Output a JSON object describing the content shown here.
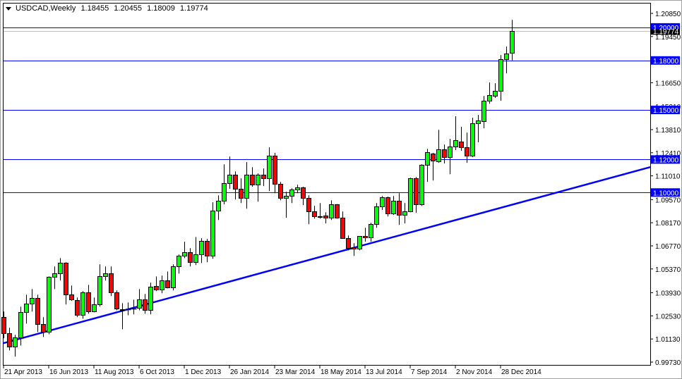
{
  "header": {
    "symbol": "USDCAD,Weekly",
    "open": "1.18455",
    "high": "1.20455",
    "low": "1.18009",
    "close": "1.19774"
  },
  "chart_data": {
    "type": "candlestick",
    "title": "USDCAD,Weekly",
    "ylim": [
      0.9973,
      1.2085
    ],
    "y_ticks": [
      "1.20850",
      "1.19450",
      "1.16650",
      "1.15210",
      "1.13810",
      "1.12410",
      "1.11010",
      "1.09570",
      "1.08170",
      "1.06770",
      "1.05370",
      "1.03930",
      "1.02530",
      "1.01130",
      "0.99730"
    ],
    "x_labels": [
      {
        "bar": 0,
        "label": "21 Apr 2013"
      },
      {
        "bar": 8,
        "label": "16 Jun 2013"
      },
      {
        "bar": 16,
        "label": "11 Aug 2013"
      },
      {
        "bar": 24,
        "label": "6 Oct 2013"
      },
      {
        "bar": 32,
        "label": "1 Dec 2013"
      },
      {
        "bar": 40,
        "label": "26 Jan 2014"
      },
      {
        "bar": 48,
        "label": "23 Mar 2014"
      },
      {
        "bar": 56,
        "label": "18 May 2014"
      },
      {
        "bar": 64,
        "label": "13 Jul 2014"
      },
      {
        "bar": 72,
        "label": "7 Sep 2014"
      },
      {
        "bar": 80,
        "label": "2 Nov 2014"
      },
      {
        "bar": 88,
        "label": "28 Dec 2014"
      }
    ],
    "horizontal_levels": [
      {
        "price": 1.2,
        "label": "1.20000"
      },
      {
        "price": 1.18,
        "label": "1.18000"
      },
      {
        "price": 1.15,
        "label": "1.15000"
      },
      {
        "price": 1.12,
        "label": "1.12000"
      },
      {
        "price": 1.1,
        "label": "1.10000"
      }
    ],
    "current_price": {
      "price": 1.19774,
      "label": "1.19774"
    },
    "trendline": [
      {
        "bar": -0.1,
        "price": 1.0087
      },
      {
        "bar": 114.5,
        "price": 1.1154
      }
    ],
    "colors": {
      "up": "#00ff00",
      "down": "#ff0000",
      "level": "#0000ff",
      "trend": "#0000ff"
    },
    "ohlc": [
      [
        1.0245,
        1.0279,
        1.0117,
        1.0146
      ],
      [
        1.0146,
        1.0181,
        1.0044,
        1.0065
      ],
      [
        1.0065,
        1.0138,
        1.0006,
        1.0121
      ],
      [
        1.0121,
        1.0309,
        1.0074,
        1.0275
      ],
      [
        1.0275,
        1.0381,
        1.0206,
        1.0326
      ],
      [
        1.0326,
        1.0415,
        1.0279,
        1.036
      ],
      [
        1.036,
        1.0381,
        1.0155,
        1.0202
      ],
      [
        1.0202,
        1.0245,
        1.0125,
        1.0155
      ],
      [
        1.0155,
        1.0492,
        1.0142,
        1.0488
      ],
      [
        1.0488,
        1.0552,
        1.0415,
        1.0509
      ],
      [
        1.0509,
        1.0603,
        1.0467,
        1.0573
      ],
      [
        1.0573,
        1.0578,
        1.0322,
        1.0381
      ],
      [
        1.0381,
        1.0437,
        1.0343,
        1.0351
      ],
      [
        1.0347,
        1.0364,
        1.0245,
        1.0257
      ],
      [
        1.0257,
        1.0403,
        1.0236,
        1.0394
      ],
      [
        1.0394,
        1.0441,
        1.0266,
        1.0279
      ],
      [
        1.0279,
        1.0364,
        1.0275,
        1.0322
      ],
      [
        1.0322,
        1.0565,
        1.0309,
        1.0492
      ],
      [
        1.0492,
        1.0552,
        1.0467,
        1.0509
      ],
      [
        1.0509,
        1.0552,
        1.0373,
        1.0394
      ],
      [
        1.0394,
        1.0407,
        1.0287,
        1.0296
      ],
      [
        1.0292,
        1.033,
        1.0172,
        1.029
      ],
      [
        1.0292,
        1.0334,
        1.0257,
        1.0294
      ],
      [
        1.0296,
        1.0351,
        1.0262,
        1.0298
      ],
      [
        1.03,
        1.0415,
        1.0287,
        1.0351
      ],
      [
        1.0351,
        1.0386,
        1.0266,
        1.0287
      ],
      [
        1.0287,
        1.0454,
        1.0262,
        1.0428
      ],
      [
        1.0433,
        1.0492,
        1.0403,
        1.0411
      ],
      [
        1.0411,
        1.0497,
        1.039,
        1.0467
      ],
      [
        1.0467,
        1.0522,
        1.042,
        1.0424
      ],
      [
        1.0424,
        1.0565,
        1.0407,
        1.0552
      ],
      [
        1.0552,
        1.0625,
        1.0509,
        1.0616
      ],
      [
        1.0616,
        1.0702,
        1.0603,
        1.0637
      ],
      [
        1.0637,
        1.0663,
        1.0552,
        1.0578
      ],
      [
        1.0578,
        1.0731,
        1.0561,
        1.0625
      ],
      [
        1.0625,
        1.0723,
        1.0573,
        1.0706
      ],
      [
        1.0706,
        1.0719,
        1.0578,
        1.0616
      ],
      [
        1.0616,
        1.0941,
        1.0599,
        1.0889
      ],
      [
        1.0889,
        1.0983,
        1.0834,
        1.0949
      ],
      [
        1.0949,
        1.1171,
        1.0928,
        1.1056
      ],
      [
        1.1056,
        1.1218,
        1.1022,
        1.1107
      ],
      [
        1.1107,
        1.1128,
        1.0958,
        1.1022
      ],
      [
        1.1022,
        1.1086,
        1.0936,
        1.0966
      ],
      [
        1.0966,
        1.1184,
        1.0902,
        1.1107
      ],
      [
        1.1107,
        1.1154,
        1.1035,
        1.1047
      ],
      [
        1.1047,
        1.1116,
        1.0945,
        1.1107
      ],
      [
        1.1107,
        1.1146,
        1.1039,
        1.1086
      ],
      [
        1.1086,
        1.1274,
        1.1009,
        1.1222
      ],
      [
        1.1222,
        1.124,
        1.0996,
        1.1052
      ],
      [
        1.1052,
        1.1064,
        1.0953,
        1.0966
      ],
      [
        1.0966,
        1.1005,
        1.0847,
        1.0979
      ],
      [
        1.0979,
        1.1026,
        1.0936,
        1.1018
      ],
      [
        1.1018,
        1.1047,
        1.0996,
        1.103
      ],
      [
        1.103,
        1.1035,
        1.0924,
        1.0966
      ],
      [
        1.0966,
        1.0983,
        1.0808,
        1.0885
      ],
      [
        1.0885,
        1.0919,
        1.0842,
        1.0855
      ],
      [
        1.0855,
        1.0936,
        1.0842,
        1.0853
      ],
      [
        1.086,
        1.0881,
        1.0813,
        1.0847
      ],
      [
        1.0847,
        1.0953,
        1.0834,
        1.0928
      ],
      [
        1.0928,
        1.093,
        1.0842,
        1.0847
      ],
      [
        1.0847,
        1.0885,
        1.0723,
        1.0723
      ],
      [
        1.0723,
        1.074,
        1.065,
        1.0663
      ],
      [
        1.0667,
        1.0693,
        1.0616,
        1.0659
      ],
      [
        1.0659,
        1.0736,
        1.065,
        1.0736
      ],
      [
        1.0736,
        1.0787,
        1.0702,
        1.0727
      ],
      [
        1.0727,
        1.0817,
        1.0702,
        1.0808
      ],
      [
        1.0808,
        1.0936,
        1.0787,
        1.0915
      ],
      [
        1.0915,
        1.0979,
        1.0894,
        1.0971
      ],
      [
        1.0971,
        1.0975,
        1.0855,
        1.0872
      ],
      [
        1.0872,
        1.0979,
        1.0864,
        1.0949
      ],
      [
        1.0949,
        1.0996,
        1.0804,
        1.0864
      ],
      [
        1.0864,
        1.0936,
        1.0813,
        1.0885
      ],
      [
        1.0885,
        1.109,
        1.0881,
        1.1086
      ],
      [
        1.1086,
        1.1094,
        1.0877,
        1.0928
      ],
      [
        1.0928,
        1.1171,
        1.0919,
        1.1167
      ],
      [
        1.1167,
        1.1265,
        1.1064,
        1.1244
      ],
      [
        1.1235,
        1.124,
        1.1073,
        1.1193
      ],
      [
        1.1188,
        1.138,
        1.118,
        1.1261
      ],
      [
        1.1261,
        1.1291,
        1.1176,
        1.1214
      ],
      [
        1.1214,
        1.1325,
        1.1111,
        1.1278
      ],
      [
        1.1278,
        1.1462,
        1.1257,
        1.1316
      ],
      [
        1.1308,
        1.1398,
        1.1253,
        1.1274
      ],
      [
        1.1274,
        1.1363,
        1.118,
        1.1222
      ],
      [
        1.1222,
        1.1453,
        1.1214,
        1.1419
      ],
      [
        1.1419,
        1.147,
        1.1304,
        1.1436
      ],
      [
        1.1432,
        1.1585,
        1.1389,
        1.1556
      ],
      [
        1.1556,
        1.1667,
        1.1538,
        1.159
      ],
      [
        1.1586,
        1.1662,
        1.1573,
        1.1615
      ],
      [
        1.1615,
        1.1833,
        1.1556,
        1.1807
      ],
      [
        1.1807,
        1.1884,
        1.1722,
        1.1842
      ],
      [
        1.18455,
        1.20455,
        1.18009,
        1.19774
      ]
    ]
  }
}
